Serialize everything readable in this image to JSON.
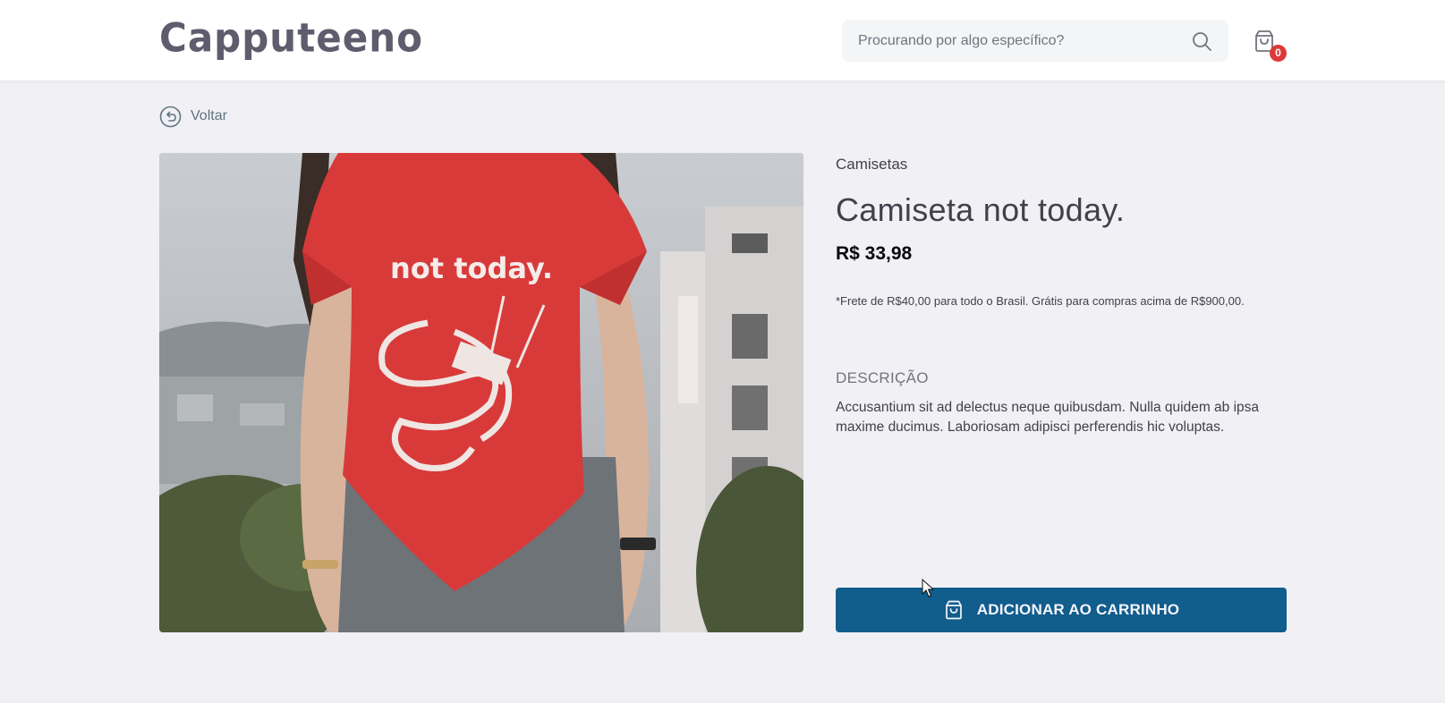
{
  "header": {
    "logo": "Capputeeno",
    "search_placeholder": "Procurando por algo específico?",
    "cart_count": "0"
  },
  "nav": {
    "back_label": "Voltar"
  },
  "product": {
    "category": "Camisetas",
    "name": "Camiseta not today.",
    "price": "R$ 33,98",
    "shipping_note": "*Frete de R$40,00 para todo o Brasil. Grátis para compras acima de R$900,00.",
    "description_title": "DESCRIÇÃO",
    "description": "Accusantium sit ad delectus neque quibusdam. Nulla quidem ab ipsa maxime ducimus. Laboriosam adipisci perferendis hic voluptas.",
    "shirt_print": "not today.",
    "add_to_cart_label": "ADICIONAR AO CARRINHO"
  },
  "colors": {
    "accent": "#115d8c",
    "badge": "#de3838",
    "background": "#f0f0f5",
    "shirt": "#d83a3a"
  }
}
